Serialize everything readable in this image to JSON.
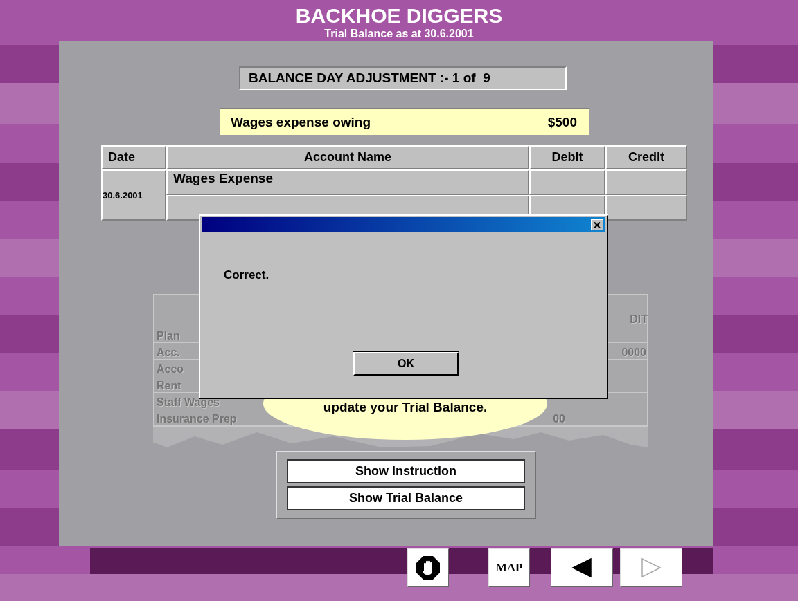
{
  "header": {
    "title": "BACKHOE DIGGERS",
    "subtitle": "Trial Balance as at 30.6.2001"
  },
  "adjustment": {
    "label": "BALANCE DAY ADJUSTMENT :- 1 of  9"
  },
  "transaction": {
    "description": "Wages expense owing",
    "amount": "$500"
  },
  "journal": {
    "columns": [
      "Date",
      "Account Name",
      "Debit",
      "Credit"
    ],
    "date": "30.6.2001",
    "rows": [
      {
        "account": "Wages Expense"
      },
      {}
    ]
  },
  "trial_balance": {
    "header": {
      "column_3": "DIT"
    },
    "rows": [
      {
        "column_1": "Plan"
      },
      {
        "column_1": "Acc.",
        "column_3": "0000"
      },
      {
        "column_1": "Acco"
      },
      {
        "column_1": "Rent"
      },
      {
        "column_1": "Staff Wages"
      },
      {
        "column_1": "Insurance Prep",
        "column_2": "00"
      }
    ]
  },
  "tooltip": {
    "text": "update your Trial Balance."
  },
  "buttons": [
    "Show instruction",
    "Show Trial Balance"
  ],
  "nav": [
    {
      "kind": "stop"
    },
    {
      "kind": "map",
      "label": "MAP"
    },
    {
      "kind": "back",
      "disabled": false
    },
    {
      "kind": "forward",
      "disabled": true
    }
  ],
  "dialog": {
    "message": "Correct.",
    "button": "OK"
  }
}
